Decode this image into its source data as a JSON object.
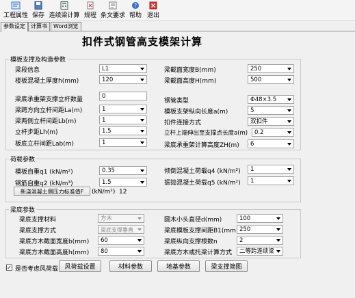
{
  "toolbar": {
    "items": [
      {
        "label": "工程属性",
        "icon": "project-icon"
      },
      {
        "label": "保存",
        "icon": "save-icon"
      },
      {
        "label": "连续梁计算",
        "icon": "calc-icon"
      },
      {
        "label": "规程",
        "icon": "code-icon"
      },
      {
        "label": "条文要求",
        "icon": "clause-icon"
      },
      {
        "label": "帮助",
        "icon": "help-icon"
      },
      {
        "label": "退出",
        "icon": "exit-icon"
      }
    ]
  },
  "tabs": [
    "参数设定",
    "计算书",
    "Word浏览"
  ],
  "title": "扣件式钢管高支模架计算",
  "formwork": {
    "legend": "模板支撑及构造参数",
    "beam_info_label": "梁段信息",
    "beam_info_value": "L1",
    "slab_thickness_label": "楼板混凝土厚度h(mm)",
    "slab_thickness_value": "120",
    "beam_width_label": "梁截面宽度B(mm)",
    "beam_width_value": "250",
    "beam_height_label": "梁截面高度H(mm)",
    "beam_height_value": "500",
    "beam_bottom_poles_label": "梁底承重架支撑立杆数量",
    "beam_bottom_poles_value": "0",
    "span_la_label": "梁跨方向立杆间距La(m)",
    "span_la_value": "1",
    "side_lb_label": "梁两侧立杆间距Lb(m)",
    "side_lb_value": "1",
    "step_lh_label": "立杆步距Lh(m)",
    "step_lh_value": "1.5",
    "slab_pole_label": "板底立杆间距Lab(m)",
    "slab_pole_value": "1",
    "pipe_type_label": "钢管类型",
    "pipe_type_value": "Φ48×3.5",
    "support_length_label": "模板支架纵向长度a(m)",
    "support_length_value": "5",
    "fastener_label": "扣件连接方式",
    "fastener_value": "双扣件",
    "extend_label": "立杆上端伸出至支撑点长度a(m)",
    "extend_value": "0.2",
    "total_height_label": "梁底承重架计算高度ZH(m)",
    "total_height_value": "6"
  },
  "loads": {
    "legend": "荷载参数",
    "self_weight_label": "模板自重q1 (kN/m²)",
    "self_weight_value": "0.35",
    "rebar_label": "钢筋自重q2 (kN/m³)",
    "rebar_value": "1.5",
    "pour_label": "倾倒混凝土荷载q4 (kN/m²)",
    "pour_value": "1",
    "vibrate_label": "振捣混凝土荷载q5 (kN/m²)",
    "vibrate_value": "1",
    "lateral_btn": "新浇混凝土侧压力标准值F",
    "lateral_unit": "(kN/m²)",
    "lateral_value": "12"
  },
  "beam_bottom": {
    "legend": "梁底参数",
    "material_label": "梁底支撑材料",
    "material_value": "方木",
    "method_label": "梁底支撑方式",
    "method_value": "梁底支撑垂直",
    "timber_width_label": "梁底方木截面宽度b(mm)",
    "timber_width_value": "60",
    "timber_height_label": "梁底方木截面高度h(mm)",
    "timber_height_value": "80",
    "round_dia_label": "圆木小头直径d(mm)",
    "round_dia_value": "100",
    "spacing_label": "梁底模板支撑间距B1(mm)",
    "spacing_value": "250",
    "count_label": "梁底纵向支撑根数n",
    "count_value": "2",
    "calc_method_label": "梁底方木或托梁计算方式",
    "calc_method_value": "二等跨连续梁"
  },
  "footer": {
    "wind_checkbox_label": "是否考虑风荷载",
    "wind_checked": true,
    "buttons": [
      "风荷载设置",
      "材料参数",
      "地基参数",
      "梁支撑简图"
    ]
  },
  "colors": {
    "accent": "#3a6fc4",
    "panel": "#f0f0f0"
  }
}
